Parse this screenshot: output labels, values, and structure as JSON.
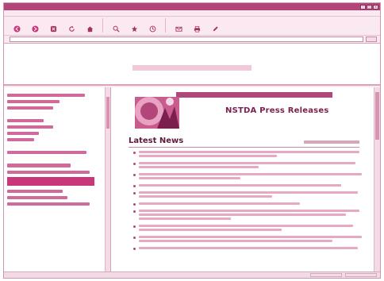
{
  "window": {
    "title": ""
  },
  "menubar": {
    "items": [
      "",
      "",
      "",
      "",
      "",
      ""
    ]
  },
  "toolbar": {
    "buttons": [
      {
        "label": "",
        "icon": "back-arrow-icon"
      },
      {
        "label": "",
        "icon": "forward-arrow-icon"
      },
      {
        "label": "",
        "icon": "stop-icon"
      },
      {
        "label": "",
        "icon": "refresh-icon"
      },
      {
        "label": "",
        "icon": "home-icon"
      },
      {
        "label": "",
        "icon": "search-icon"
      },
      {
        "label": "",
        "icon": "favorites-icon"
      },
      {
        "label": "",
        "icon": "history-icon"
      },
      {
        "label": "",
        "icon": "mail-icon"
      },
      {
        "label": "",
        "icon": "print-icon"
      },
      {
        "label": "",
        "icon": "edit-icon"
      }
    ]
  },
  "addressbar": {
    "label": "",
    "url": ""
  },
  "top_banner": {
    "line1": "",
    "line2": ""
  },
  "sidebar": {
    "items": []
  },
  "main": {
    "banner_title": "NSTDA Press Releases",
    "news_heading": "Latest News",
    "date_text": "",
    "news_items": [
      {
        "title": ""
      },
      {
        "title": ""
      },
      {
        "title": ""
      },
      {
        "title": ""
      },
      {
        "title": ""
      },
      {
        "title": ""
      },
      {
        "title": ""
      },
      {
        "title": ""
      },
      {
        "title": ""
      },
      {
        "title": ""
      }
    ]
  },
  "status": {
    "text": ""
  },
  "colors": {
    "accent": "#b2467a",
    "link": "#cf6a9b",
    "highlight": "#c9367a",
    "background": "#fbe9f1"
  }
}
